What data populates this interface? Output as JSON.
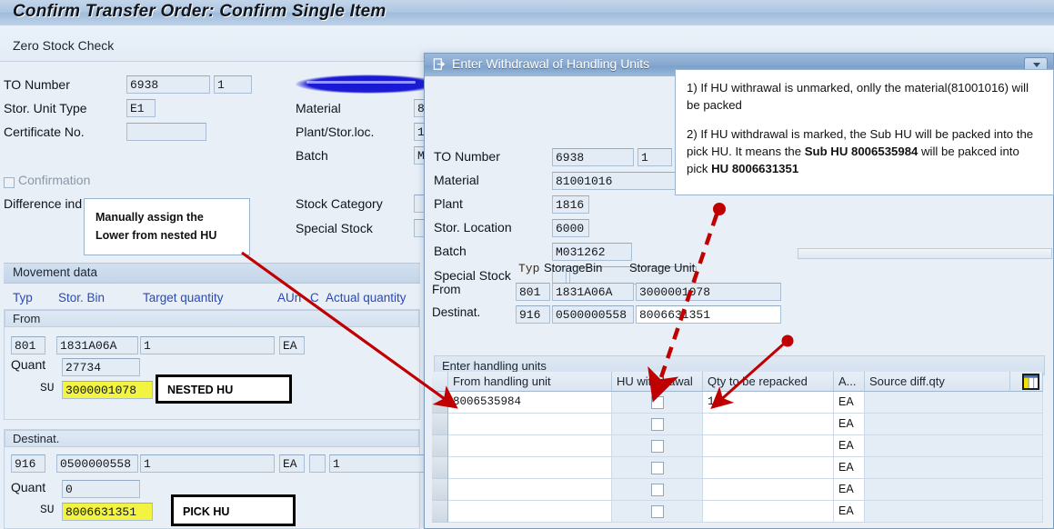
{
  "window": {
    "title": "Confirm Transfer Order: Confirm Single Item",
    "subtitle": "Zero Stock Check",
    "left_fields": [
      {
        "label": "TO Number",
        "value": "6938",
        "value2": "1"
      },
      {
        "label": "Stor. Unit Type",
        "value": "E1",
        "value2": ""
      },
      {
        "label": "Certificate No.",
        "value": "",
        "value2": ""
      }
    ],
    "right_fields": [
      {
        "label": "",
        "value": ""
      },
      {
        "label": "Material",
        "value": "8"
      },
      {
        "label": "Plant/Stor.loc.",
        "value": "1"
      },
      {
        "label": "Batch",
        "value": "M"
      },
      {
        "label": "Stock Category",
        "value": ""
      },
      {
        "label": "Special Stock",
        "value": ""
      }
    ],
    "confirmation_label": "Confirmation",
    "difference_label": "Difference ind",
    "movement_section": "Movement data",
    "movement_columns": [
      "Typ",
      "Stor. Bin",
      "Target quantity",
      "AUn",
      "C",
      "Actual quantity"
    ],
    "from_group": {
      "title": "From",
      "typ": "801",
      "bin": "1831A06A",
      "qty": "1",
      "unit": "EA",
      "quant_label": "Quant",
      "quant": "27734",
      "su_label": "SU",
      "su": "3000001078"
    },
    "dest_group": {
      "title": "Destinat.",
      "typ": "916",
      "bin": "0500000558",
      "qty": "1",
      "unit": "EA",
      "c": "",
      "actual": "1",
      "quant_label": "Quant",
      "quant": "0",
      "su_label": "SU",
      "su": "8006631351"
    }
  },
  "dialog": {
    "title": "Enter Withdrawal of Handling Units",
    "restore_icon": "chevron-down-icon",
    "fields": [
      {
        "label": "TO Number",
        "value": "6938",
        "value2": "1"
      },
      {
        "label": "Material",
        "value": "81001016",
        "value2": ""
      },
      {
        "label": "Plant",
        "value": "1816",
        "value2": ""
      },
      {
        "label": "Stor. Location",
        "value": "6000",
        "value2": ""
      },
      {
        "label": "Batch",
        "value": "M031262",
        "value2": ""
      },
      {
        "label": "Special Stock",
        "value": "",
        "value2": ""
      }
    ],
    "loc_columns": [
      "Typ",
      "StorageBin",
      "Storage Unit"
    ],
    "loc_rows": [
      {
        "label": "From",
        "typ": "801",
        "bin": "1831A06A",
        "unit": "3000001078"
      },
      {
        "label": "Destinat.",
        "typ": "916",
        "bin": "0500000558",
        "unit": "8006631351"
      }
    ],
    "table": {
      "group_title": "Enter handling units",
      "columns": [
        "From handling unit",
        "HU withdrawal",
        "Qty to be repacked",
        "A...",
        "Source diff.qty"
      ],
      "config_icon": "column-config-icon",
      "rows": [
        {
          "hu": "8006535984",
          "withdrawal": false,
          "qty": "1",
          "auom": "EA",
          "diffqty": ""
        },
        {
          "hu": "",
          "withdrawal": false,
          "qty": "",
          "auom": "EA",
          "diffqty": ""
        },
        {
          "hu": "",
          "withdrawal": false,
          "qty": "",
          "auom": "EA",
          "diffqty": ""
        },
        {
          "hu": "",
          "withdrawal": false,
          "qty": "",
          "auom": "EA",
          "diffqty": ""
        },
        {
          "hu": "",
          "withdrawal": false,
          "qty": "",
          "auom": "EA",
          "diffqty": ""
        },
        {
          "hu": "",
          "withdrawal": false,
          "qty": "",
          "auom": "EA",
          "diffqty": ""
        }
      ]
    }
  },
  "annotations": {
    "note_manual": "Manually assign the\nLower from nested HU",
    "label_nested": "NESTED HU",
    "label_pick": "PICK HU",
    "explain_line1": "1) If HU withrawal is unmarked, onlly the material(81001016) will be packed",
    "explain_line2a": "2) If HU withdrawal is marked, the Sub HU will be packed into the pick HU. It means the ",
    "explain_bold1": "Sub HU 8006535984",
    "explain_line2b": " will be pakced into pick ",
    "explain_bold2": "HU 8006631351",
    "arrow_color": "#c00000",
    "highlight_color": "#f2f441"
  }
}
